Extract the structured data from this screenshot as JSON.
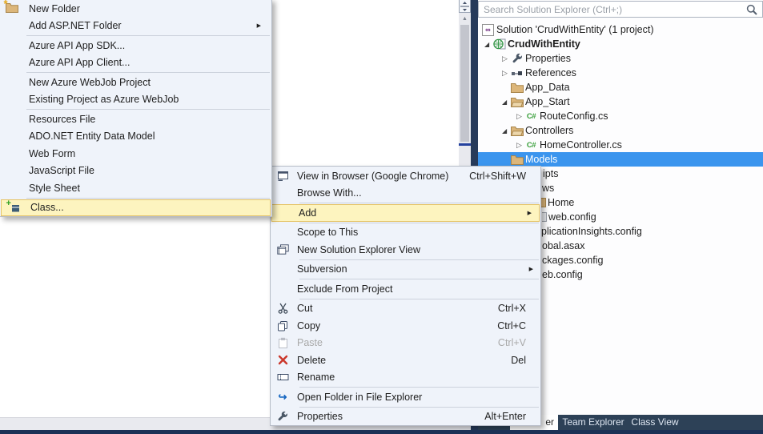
{
  "icons": {
    "submenu_arrow": "▶",
    "tree_collapsed": "▷",
    "tree_expanded": "◢",
    "open_folder_arrow": "↪",
    "csharp_file": "C#",
    "solution_mark": "∞",
    "class_plus": "+",
    "new_folder_star": "*",
    "scroll_up": "▲"
  },
  "colors": {
    "selection_blue": "#3b95ee",
    "menu_bg": "#eff3fa",
    "menu_highlight": "#fdf4bf",
    "menu_highlight_border": "#e5c365",
    "dark_shell": "#263a5a",
    "tab_bar": "#2d4157",
    "folder_tan": "#dcb67a",
    "csharp_green": "#379e38",
    "delete_red": "#cb372b"
  },
  "add_submenu": {
    "items": [
      {
        "label": "New Folder",
        "icon": "new-folder-icon"
      },
      {
        "label": "Add ASP.NET Folder",
        "has_submenu": true
      },
      {
        "label": "Azure API App SDK..."
      },
      {
        "label": "Azure API App Client..."
      },
      {
        "label": "New Azure WebJob Project"
      },
      {
        "label": "Existing Project as Azure WebJob"
      },
      {
        "label": "Resources File"
      },
      {
        "label": "ADO.NET Entity Data Model"
      },
      {
        "label": "Web Form"
      },
      {
        "label": "JavaScript File"
      },
      {
        "label": "Style Sheet"
      },
      {
        "label": "Class...",
        "icon": "class-icon",
        "highlighted": true
      }
    ]
  },
  "context_menu": {
    "items": [
      {
        "label": "View in Browser (Google Chrome)",
        "shortcut": "Ctrl+Shift+W",
        "icon": "browser-icon"
      },
      {
        "label": "Browse With..."
      },
      {
        "label": "Add",
        "has_submenu": true,
        "highlighted": true
      },
      {
        "label": "Scope to This"
      },
      {
        "label": "New Solution Explorer View",
        "icon": "new-view-icon"
      },
      {
        "label": "Subversion",
        "has_submenu": true
      },
      {
        "label": "Exclude From Project"
      },
      {
        "label": "Cut",
        "shortcut": "Ctrl+X",
        "icon": "scissors-icon"
      },
      {
        "label": "Copy",
        "shortcut": "Ctrl+C",
        "icon": "copy-icon"
      },
      {
        "label": "Paste",
        "shortcut": "Ctrl+V",
        "icon": "paste-icon",
        "disabled": true
      },
      {
        "label": "Delete",
        "shortcut": "Del",
        "icon": "delete-icon"
      },
      {
        "label": "Rename",
        "icon": "rename-icon"
      },
      {
        "label": "Open Folder in File Explorer",
        "icon": "open-folder-icon"
      },
      {
        "label": "Properties",
        "shortcut": "Alt+Enter",
        "icon": "wrench-icon"
      }
    ]
  },
  "solution_explorer": {
    "search": {
      "placeholder": "Search Solution Explorer (Ctrl+;)"
    },
    "tree": {
      "rows": [
        {
          "label": "Solution 'CrudWithEntity' (1 project)",
          "icon": "solution-icon",
          "level": 0
        },
        {
          "label": "CrudWithEntity",
          "icon": "web-project-icon",
          "level": 1,
          "expanded": true,
          "bold": true
        },
        {
          "label": "Properties",
          "icon": "wrench-icon",
          "level": 2,
          "collapsed": true
        },
        {
          "label": "References",
          "icon": "references-icon",
          "level": 2,
          "collapsed": true
        },
        {
          "label": "App_Data",
          "icon": "folder-icon",
          "level": 2
        },
        {
          "label": "App_Start",
          "icon": "folder-open-icon",
          "level": 2,
          "expanded": true
        },
        {
          "label": "RouteConfig.cs",
          "icon": "csharp-file-icon",
          "level": 3,
          "collapsed": true
        },
        {
          "label": "Controllers",
          "icon": "folder-open-icon",
          "level": 2,
          "expanded": true
        },
        {
          "label": "HomeController.cs",
          "icon": "csharp-file-icon",
          "level": 3,
          "collapsed": true
        },
        {
          "label": "Models",
          "icon": "folder-icon",
          "level": 2,
          "selected": true
        }
      ],
      "partially_hidden_rows": [
        {
          "visible_text": "ipts"
        },
        {
          "visible_text": "ws"
        },
        {
          "visible_text": "Home"
        },
        {
          "visible_text": "web.config"
        },
        {
          "visible_text": "plicationInsights.config"
        },
        {
          "visible_text": "obal.asax"
        },
        {
          "visible_text": "ckages.config"
        },
        {
          "visible_text": "eb.config"
        }
      ]
    },
    "tabs": {
      "active_fragment": "er",
      "items": [
        {
          "label": "Team Explorer"
        },
        {
          "label": "Class View"
        }
      ]
    }
  }
}
